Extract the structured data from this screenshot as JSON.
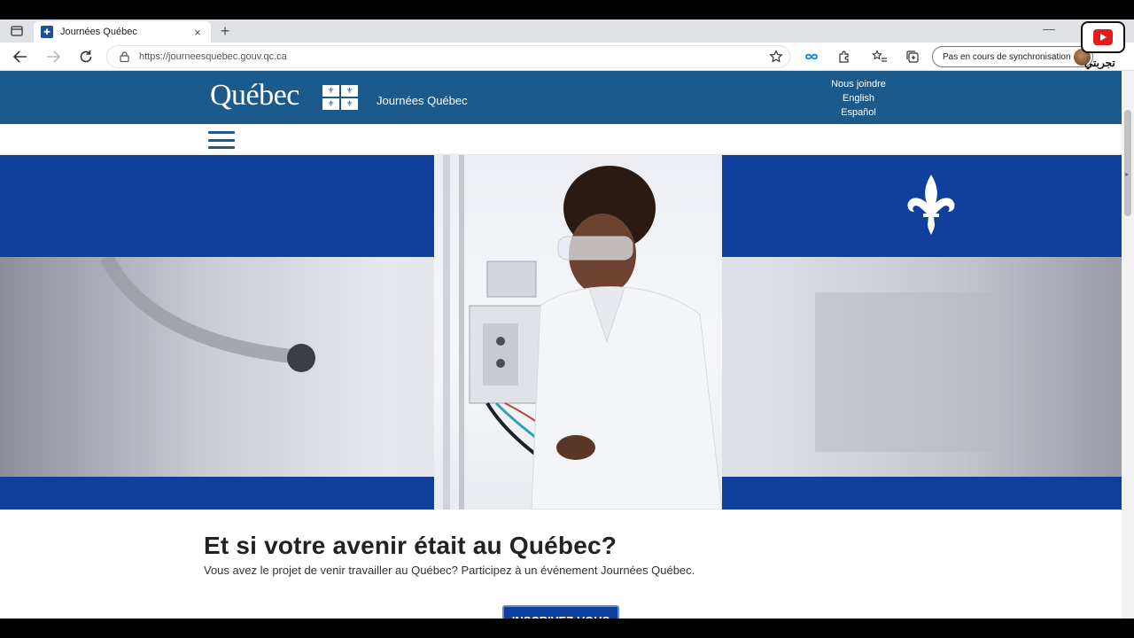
{
  "browser": {
    "tab": {
      "title": "Journées Québec",
      "close": "×"
    },
    "new_tab": "+",
    "window_minimize": "—",
    "address": {
      "url": "https://journeesquebec.gouv.qc.ca"
    },
    "sync_status": "Pas en cours de synchronisation"
  },
  "site": {
    "logo_word": "Québec",
    "logo_fleur": "⚜",
    "site_name": "Journées Québec",
    "header_links": [
      "Nous joindre",
      "English",
      "Español"
    ],
    "hero": {
      "brand_blue": "#103f9e"
    },
    "heading": "Et si votre avenir était au Québec?",
    "subheading": "Vous avez le projet de venir travailler au Québec? Participez à un événement Journées Québec.",
    "cta_label": "INSCRIVEZ-VOUS"
  },
  "watermark": {
    "text": "تجربتي"
  },
  "colors": {
    "header_blue": "#1b5a8a",
    "hero_blue": "#103f9e"
  }
}
